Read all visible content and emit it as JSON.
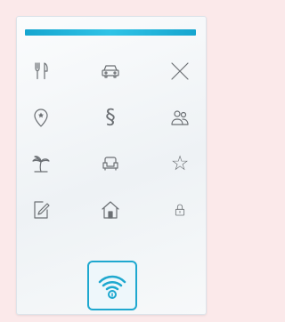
{
  "screen": {
    "background": "#fbe9ea",
    "accent": "#1ea8cf"
  },
  "grid": {
    "items": [
      {
        "icon": "fork-knife-icon",
        "label": ""
      },
      {
        "icon": "car-icon",
        "label": ""
      },
      {
        "icon": "close-icon",
        "label": ""
      },
      {
        "icon": "location-pin-icon",
        "label": ""
      },
      {
        "icon": "section-sign-icon",
        "label": "§"
      },
      {
        "icon": "people-icon",
        "label": ""
      },
      {
        "icon": "palm-tree-icon",
        "label": ""
      },
      {
        "icon": "armchair-icon",
        "label": ""
      },
      {
        "icon": "star-icon",
        "label": "☆"
      },
      {
        "icon": "edit-icon",
        "label": ""
      },
      {
        "icon": "home-icon",
        "label": ""
      },
      {
        "icon": "lock-icon",
        "label": ""
      }
    ]
  },
  "action": {
    "icon": "wifi-lock-icon"
  }
}
